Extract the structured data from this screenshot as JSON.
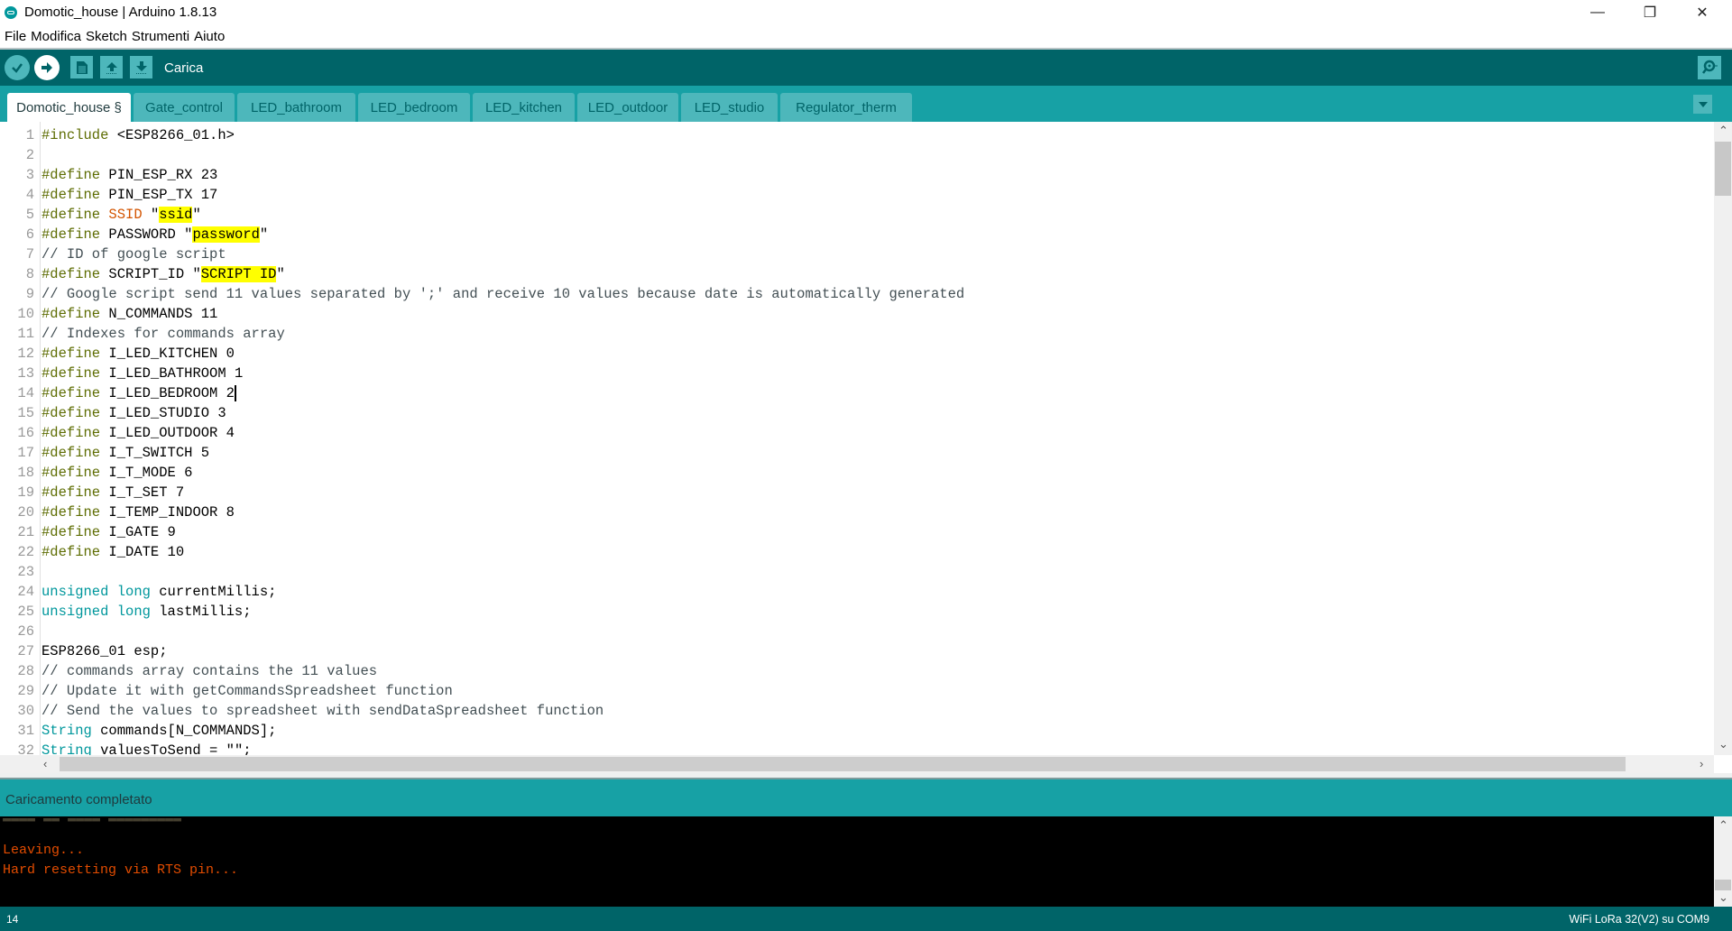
{
  "window": {
    "title": "Domotic_house | Arduino 1.8.13",
    "controls": {
      "minimize": "—",
      "restore": "❐",
      "close": "✕"
    }
  },
  "menu": [
    "File",
    "Modifica",
    "Sketch",
    "Strumenti",
    "Aiuto"
  ],
  "toolbar": {
    "hover_label": "Carica",
    "buttons": [
      "verify",
      "upload",
      "new",
      "open",
      "save"
    ],
    "serial_monitor": "serial-monitor"
  },
  "tabs": [
    {
      "label": "Domotic_house §",
      "active": true
    },
    {
      "label": "Gate_control",
      "active": false
    },
    {
      "label": "LED_bathroom",
      "active": false
    },
    {
      "label": "LED_bedroom",
      "active": false
    },
    {
      "label": "LED_kitchen",
      "active": false
    },
    {
      "label": "LED_outdoor",
      "active": false
    },
    {
      "label": "LED_studio",
      "active": false
    },
    {
      "label": "Regulator_therm",
      "active": false
    }
  ],
  "editor": {
    "caret_line": 14,
    "lines": [
      {
        "n": "1",
        "parts": [
          [
            "kw",
            "#include"
          ],
          [
            "plain",
            " <ESP8266_01.h>"
          ]
        ]
      },
      {
        "n": "2",
        "parts": []
      },
      {
        "n": "3",
        "parts": [
          [
            "kw",
            "#define"
          ],
          [
            "plain",
            " PIN_ESP_RX 23"
          ]
        ]
      },
      {
        "n": "4",
        "parts": [
          [
            "kw",
            "#define"
          ],
          [
            "plain",
            " PIN_ESP_TX 17"
          ]
        ]
      },
      {
        "n": "5",
        "parts": [
          [
            "kw",
            "#define"
          ],
          [
            "ssid",
            " SSID"
          ],
          [
            "plain",
            " \""
          ],
          [
            "hl",
            "ssid"
          ],
          [
            "plain",
            "\""
          ]
        ]
      },
      {
        "n": "6",
        "parts": [
          [
            "kw",
            "#define"
          ],
          [
            "plain",
            " PASSWORD \""
          ],
          [
            "hl",
            "password"
          ],
          [
            "plain",
            "\""
          ]
        ]
      },
      {
        "n": "7",
        "parts": [
          [
            "cm",
            "// ID of google script"
          ]
        ]
      },
      {
        "n": "8",
        "parts": [
          [
            "kw",
            "#define"
          ],
          [
            "plain",
            " SCRIPT_ID \""
          ],
          [
            "hl",
            "SCRIPT ID"
          ],
          [
            "plain",
            "\""
          ]
        ]
      },
      {
        "n": "9",
        "parts": [
          [
            "cm",
            "// Google script send 11 values separated by ';' and receive 10 values because date is automatically generated"
          ]
        ]
      },
      {
        "n": "10",
        "parts": [
          [
            "kw",
            "#define"
          ],
          [
            "plain",
            " N_COMMANDS 11"
          ]
        ]
      },
      {
        "n": "11",
        "parts": [
          [
            "cm",
            "// Indexes for commands array"
          ]
        ]
      },
      {
        "n": "12",
        "parts": [
          [
            "kw",
            "#define"
          ],
          [
            "plain",
            " I_LED_KITCHEN 0"
          ]
        ]
      },
      {
        "n": "13",
        "parts": [
          [
            "kw",
            "#define"
          ],
          [
            "plain",
            " I_LED_BATHROOM 1"
          ]
        ]
      },
      {
        "n": "14",
        "parts": [
          [
            "kw",
            "#define"
          ],
          [
            "plain",
            " I_LED_BEDROOM 2"
          ]
        ]
      },
      {
        "n": "15",
        "parts": [
          [
            "kw",
            "#define"
          ],
          [
            "plain",
            " I_LED_STUDIO 3"
          ]
        ]
      },
      {
        "n": "16",
        "parts": [
          [
            "kw",
            "#define"
          ],
          [
            "plain",
            " I_LED_OUTDOOR 4"
          ]
        ]
      },
      {
        "n": "17",
        "parts": [
          [
            "kw",
            "#define"
          ],
          [
            "plain",
            " I_T_SWITCH 5"
          ]
        ]
      },
      {
        "n": "18",
        "parts": [
          [
            "kw",
            "#define"
          ],
          [
            "plain",
            " I_T_MODE 6"
          ]
        ]
      },
      {
        "n": "19",
        "parts": [
          [
            "kw",
            "#define"
          ],
          [
            "plain",
            " I_T_SET 7"
          ]
        ]
      },
      {
        "n": "20",
        "parts": [
          [
            "kw",
            "#define"
          ],
          [
            "plain",
            " I_TEMP_INDOOR 8"
          ]
        ]
      },
      {
        "n": "21",
        "parts": [
          [
            "kw",
            "#define"
          ],
          [
            "plain",
            " I_GATE 9"
          ]
        ]
      },
      {
        "n": "22",
        "parts": [
          [
            "kw",
            "#define"
          ],
          [
            "plain",
            " I_DATE 10"
          ]
        ]
      },
      {
        "n": "23",
        "parts": []
      },
      {
        "n": "24",
        "parts": [
          [
            "type",
            "unsigned long"
          ],
          [
            "plain",
            " currentMillis;"
          ]
        ]
      },
      {
        "n": "25",
        "parts": [
          [
            "type",
            "unsigned long"
          ],
          [
            "plain",
            " lastMillis;"
          ]
        ]
      },
      {
        "n": "26",
        "parts": []
      },
      {
        "n": "27",
        "parts": [
          [
            "plain",
            "ESP8266_01 esp;"
          ]
        ]
      },
      {
        "n": "28",
        "parts": [
          [
            "cm",
            "// commands array contains the 11 values"
          ]
        ]
      },
      {
        "n": "29",
        "parts": [
          [
            "cm",
            "// Update it with getCommandsSpreadsheet function"
          ]
        ]
      },
      {
        "n": "30",
        "parts": [
          [
            "cm",
            "// Send the values to spreadsheet with sendDataSpreadsheet function"
          ]
        ]
      },
      {
        "n": "31",
        "parts": [
          [
            "type",
            "String"
          ],
          [
            "plain",
            " commands[N_COMMANDS];"
          ]
        ]
      },
      {
        "n": "32",
        "parts": [
          [
            "type",
            "String"
          ],
          [
            "plain",
            " valuesToSend = \"\";"
          ]
        ]
      }
    ]
  },
  "status": {
    "message": "Caricamento completato"
  },
  "console": {
    "lines": [
      "Leaving...",
      "Hard resetting via RTS pin..."
    ]
  },
  "footer": {
    "line_number": "14",
    "board": "WiFi LoRa 32(V2) su COM9"
  },
  "colors": {
    "toolbar": "#006468",
    "tabs_bar": "#17a1a5",
    "tab_inactive": "#4db7bb",
    "keyword": "#5e6d03",
    "type": "#00979c",
    "console_text": "#e34c00",
    "highlight": "#ffff00"
  }
}
